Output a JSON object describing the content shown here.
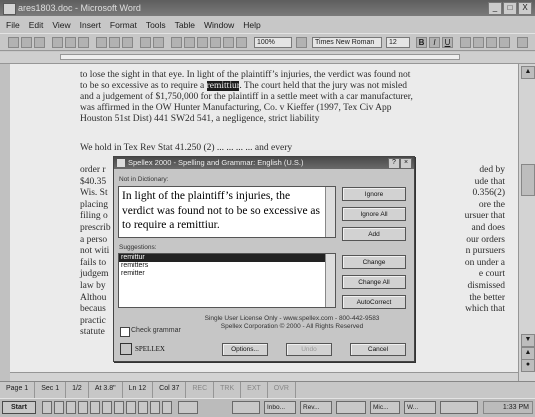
{
  "window": {
    "title": "ares1803.doc - Microsoft Word",
    "min": "_",
    "max": "□",
    "close": "X"
  },
  "menu": [
    "File",
    "Edit",
    "View",
    "Insert",
    "Format",
    "Tools",
    "Table",
    "Window",
    "Help"
  ],
  "toolbar": {
    "zoom": "100%",
    "font": "Times New Roman",
    "size": "12",
    "bold": "B",
    "italic": "I",
    "underline": "U"
  },
  "doc": {
    "para1_a": "to lose the sight in that eye. In light of the plaintiff’s injuries, the verdict was found not",
    "para1_b_pre": "to be so excessive as to require a ",
    "para1_b_hl": "remittiur",
    "para1_b_post": ". The court held that the jury was not misled",
    "para1_c": "and a judgement of $1,750,000 for the plaintiff in a settle meet with a car manufacturer,",
    "para1_d": "was affirmed in the OW Hunter Manufacturing, Co. v Kieffer (1997, Tex Civ App",
    "para1_e": "Houston 51st Dist) 441 SW2d 541, a negligence, strict liability",
    "para2_a": "We hold in Tex Rev Stat 41.250 (2) ... ... ... ... and every",
    "left_col": [
      "order r",
      "$40.35",
      "Wis. St",
      "placing",
      "filing o",
      "prescrib",
      "a perso",
      "not witi",
      "fails to",
      "judgem",
      "law by",
      "Althou",
      "becaus",
      "practic",
      "statute"
    ],
    "right_col": [
      "ded by",
      "ude that",
      "0.356(2)",
      "ore the",
      "",
      "ursuer that",
      "and does",
      "our orders",
      "n pursuers",
      "on under a",
      "e court",
      "dismissed",
      "the better",
      "which that",
      ""
    ]
  },
  "dialog": {
    "title": "Spelling and Grammar: English (U.S.)",
    "product": "Spellex 2000 - Spelling and Grammar: English (U.S.)",
    "not_label": "Not in Dictionary:",
    "sentence_pre": "In light of the plaintiff’s injuries, the verdict was found not to be so excessive as to require a ",
    "sentence_word": "remittiur",
    "sentence_post": ".",
    "suggestions_label": "Suggestions:",
    "suggestions": [
      "remittur",
      "remitters",
      "remitter"
    ],
    "buttons": {
      "ignore": "Ignore",
      "ignore_all": "Ignore All",
      "add": "Add",
      "change": "Change",
      "change_all": "Change All",
      "autocorrect": "AutoCorrect"
    },
    "check_grammar": "Check grammar",
    "license": "Single User License Only - www.spellex.com - 800-442-9583",
    "copyright": "Spellex Corporation © 2000 - All Rights Reserved",
    "logo": "SPELLEX",
    "options": "Options...",
    "undo": "Undo",
    "cancel": "Cancel"
  },
  "status": [
    "Page 1",
    "Sec 1",
    "1/2",
    "At 3.8\"",
    "Ln 12",
    "Col 37",
    "REC",
    "TRK",
    "EXT",
    "OVR"
  ],
  "taskbar": {
    "start": "Start",
    "tasks": [
      "Inbo...",
      "Rev...",
      "Mic...",
      "W..."
    ],
    "clock": "1:33 PM"
  }
}
